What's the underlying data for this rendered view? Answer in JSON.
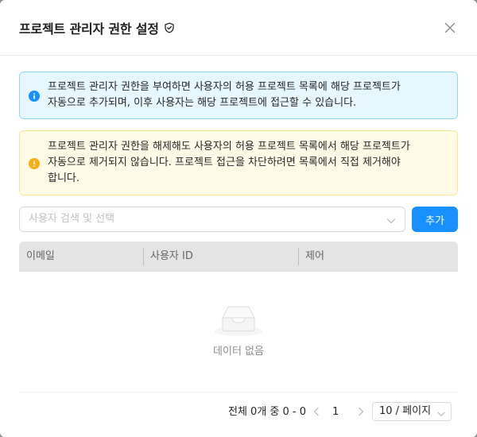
{
  "modal": {
    "title": "프로젝트 관리자 권한 설정"
  },
  "alerts": {
    "info": {
      "lines": [
        "프로젝트 관리자 권한을 부여하면 사용자의 허용 프로젝트 목록에 해당 프로젝트가",
        "자동으로 추가되며, 이후 사용자는 해당 프로젝트에 접근할 수 있습니다."
      ],
      "color": "#1890ff"
    },
    "warning": {
      "lines": [
        "프로젝트 관리자 권한을 해제해도 사용자의 허용 프로젝트 목록에서 해당 프로젝트가",
        "자동으로 제거되지 않습니다. 프로젝트 접근을 차단하려면 목록에서 직접 제거해야",
        "합니다."
      ],
      "color": "#faad14"
    }
  },
  "user_select": {
    "placeholder": "사용자 검색 및 선택"
  },
  "add_button": {
    "label": "추가"
  },
  "table": {
    "columns": [
      "이메일",
      "사용자 ID",
      "제어"
    ],
    "empty_text": "데이터 없음"
  },
  "pagination": {
    "total_text": "전체 0개 중 0 - 0",
    "current_page": "1",
    "page_size": "10 / 페이지"
  },
  "colors": {
    "accent": "#1890ff"
  }
}
